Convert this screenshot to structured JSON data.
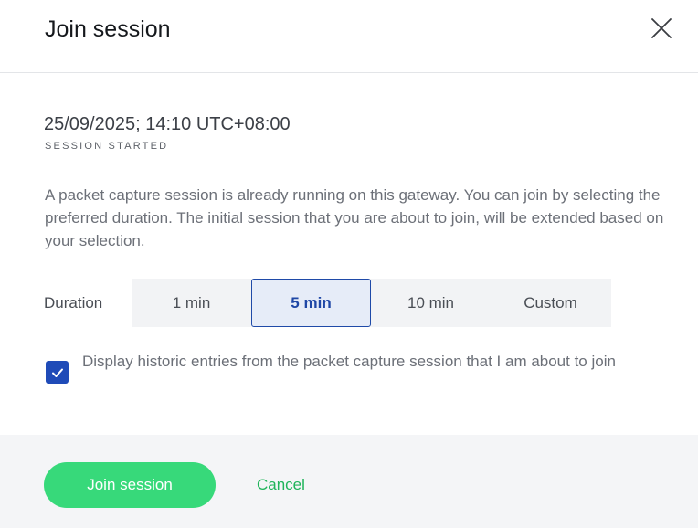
{
  "dialog": {
    "title": "Join session",
    "close_icon": "close-icon"
  },
  "session": {
    "started_at": "25/09/2025; 14:10 UTC+08:00",
    "started_label": "SESSION STARTED",
    "description": "A packet capture session is already running on this gateway. You can join by selecting the preferred duration. The initial session that you are about to join, will be extended based on your selection."
  },
  "duration": {
    "label": "Duration",
    "options": [
      "1 min",
      "5 min",
      "10 min",
      "Custom"
    ],
    "selected": "5 min"
  },
  "historic": {
    "checked": true,
    "check_icon": "checkmark-icon",
    "label": "Display historic entries from the packet capture session that I am about to join"
  },
  "footer": {
    "join_label": "Join session",
    "cancel_label": "Cancel"
  },
  "colors": {
    "primary_green": "#37d97a",
    "link_green": "#1fb45a",
    "selected_blue": "#1f47a6",
    "checkbox_blue": "#1f4bb8"
  }
}
